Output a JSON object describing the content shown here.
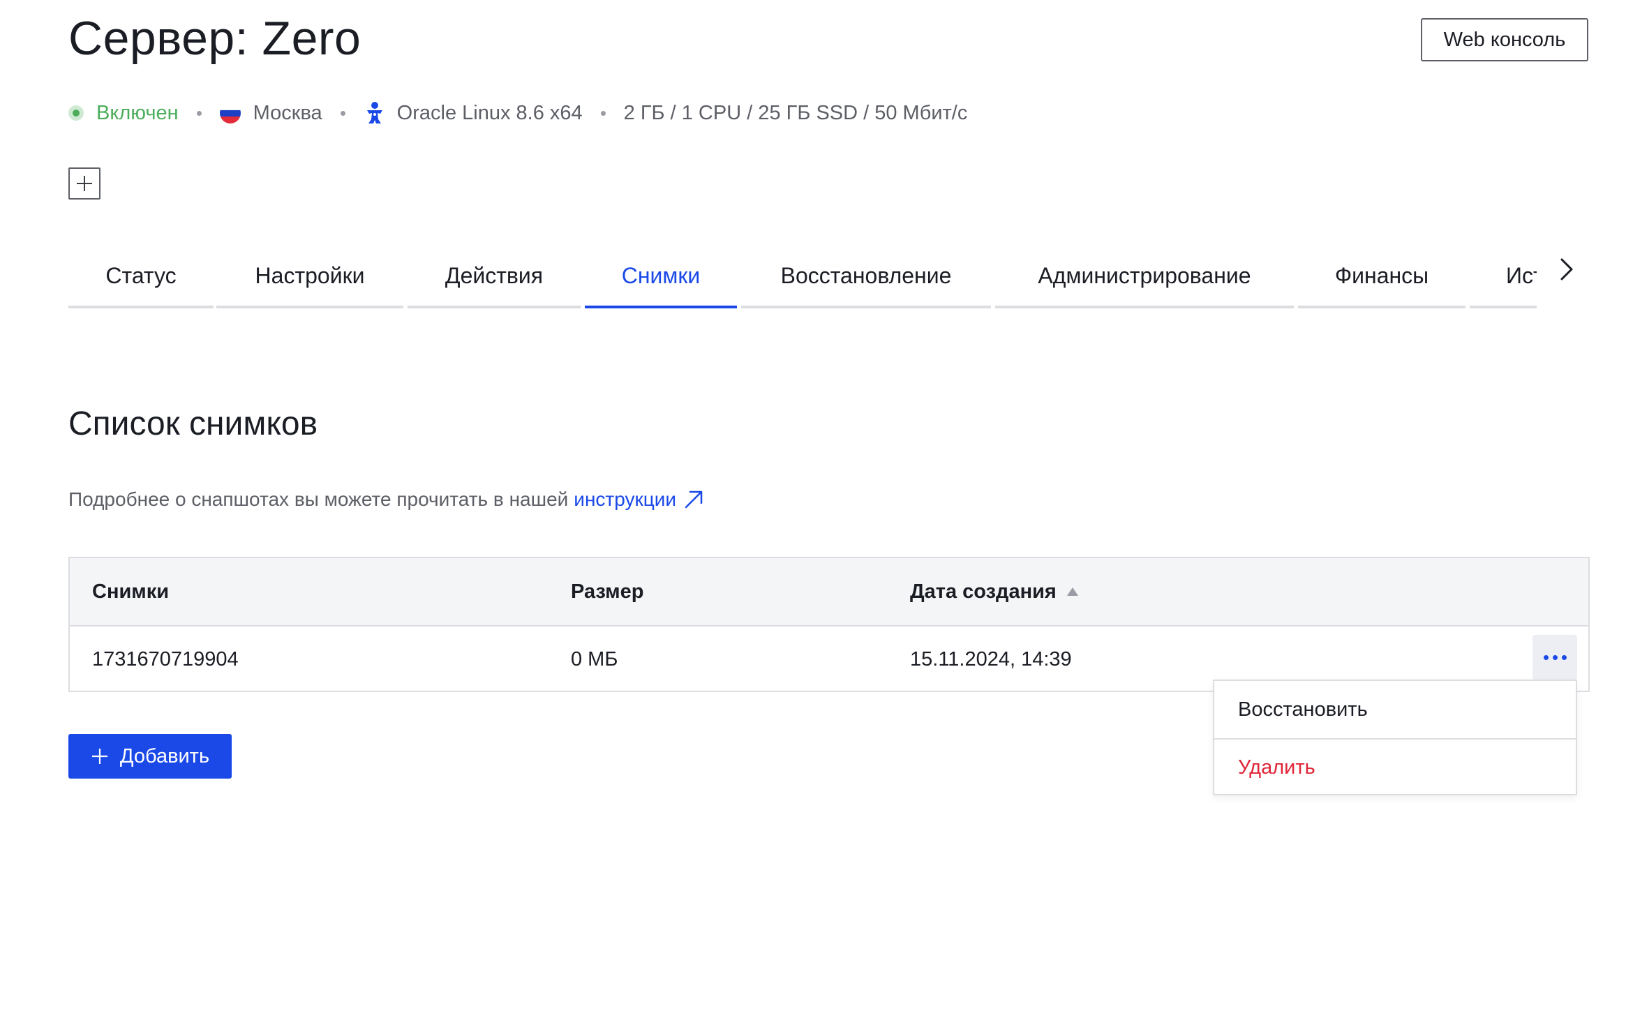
{
  "header": {
    "title": "Сервер: Zero",
    "web_console_label": "Web консоль"
  },
  "meta": {
    "status": "Включен",
    "status_color": "#4cae5b",
    "location": "Москва",
    "os": "Oracle Linux 8.6 x64",
    "specs": "2 ГБ / 1 CPU / 25 ГБ SSD / 50 Мбит/с"
  },
  "tabs": [
    {
      "label": "Статус"
    },
    {
      "label": "Настройки"
    },
    {
      "label": "Действия"
    },
    {
      "label": "Снимки",
      "active": true
    },
    {
      "label": "Восстановление"
    },
    {
      "label": "Администрирование"
    },
    {
      "label": "Финансы"
    },
    {
      "label": "История"
    }
  ],
  "snapshots": {
    "title": "Список снимков",
    "hint_text": "Подробнее о снапшотах вы можете прочитать в нашей",
    "hint_link": "инструкции",
    "columns": [
      "Снимки",
      "Размер",
      "Дата создания"
    ],
    "rows": [
      {
        "name": "1731670719904",
        "size": "0 МБ",
        "created": "15.11.2024, 14:39"
      }
    ],
    "menu": {
      "restore": "Восстановить",
      "delete": "Удалить"
    },
    "add_label": "Добавить"
  },
  "colors": {
    "accent": "#1a49e8",
    "danger": "#e0263a"
  }
}
